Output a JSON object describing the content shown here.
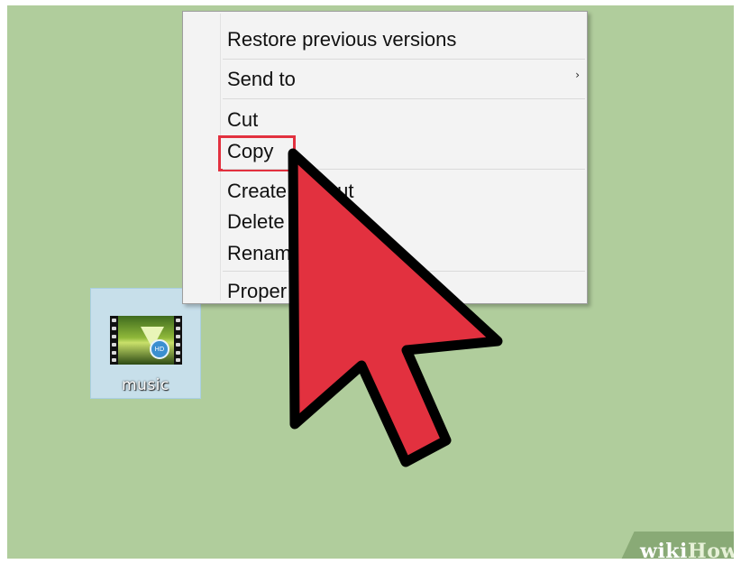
{
  "context_menu": {
    "items": [
      {
        "label": "Restore previous versions"
      },
      {
        "label": "Send to",
        "has_submenu": true,
        "submenu_arrow": "›"
      },
      {
        "label": "Cut"
      },
      {
        "label": "Copy",
        "highlighted": true
      },
      {
        "label": "Create shortcut",
        "visible_text": "Create"
      },
      {
        "label": "Delete"
      },
      {
        "label": "Rename",
        "visible_text": "Renam"
      },
      {
        "label": "Properties",
        "visible_text": "Proper"
      }
    ],
    "partial_text_after_cursor": "tcut"
  },
  "desktop": {
    "background_color": "#b0cd9c",
    "file": {
      "name": "music",
      "icon": "video-file-icon",
      "badge_icon": "media-badge-icon",
      "badge_text": "HD"
    }
  },
  "overlay": {
    "pointer_icon": "large-cursor-arrow-icon",
    "pointer_color": "#e2313f",
    "highlight_color": "#e2313f"
  },
  "watermark": {
    "part1": "wiki",
    "part2": "How"
  }
}
